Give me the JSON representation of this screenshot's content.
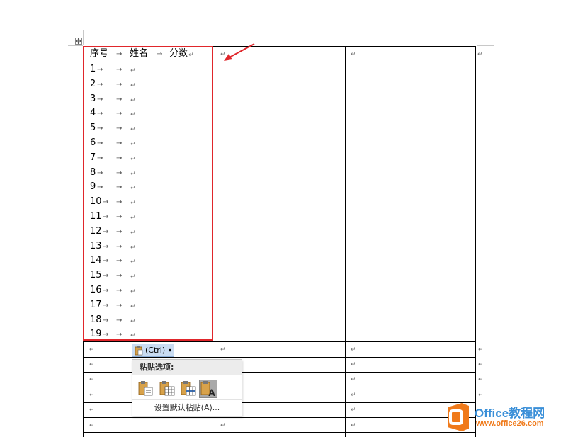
{
  "header": {
    "seq": "序号",
    "name": "姓名",
    "score": "分数"
  },
  "rows": [
    "1",
    "2",
    "3",
    "4",
    "5",
    "6",
    "7",
    "8",
    "9",
    "10",
    "11",
    "12",
    "13",
    "14",
    "15",
    "16",
    "17",
    "18",
    "19"
  ],
  "symbols": {
    "tab": "→",
    "para": "↵"
  },
  "paste_button": {
    "label": "(Ctrl)"
  },
  "paste_popup": {
    "title": "粘贴选项:",
    "options": [
      "keep-source-formatting",
      "merge-table",
      "nest-table",
      "keep-text-only"
    ],
    "default_link": "设置默认粘贴(A)..."
  },
  "watermark": {
    "brand": "Office教程网",
    "url": "www.office26.com"
  },
  "colors": {
    "highlight": "#e0262b",
    "logo_orange": "#f07a1a",
    "logo_blue": "#3a8fd8"
  }
}
